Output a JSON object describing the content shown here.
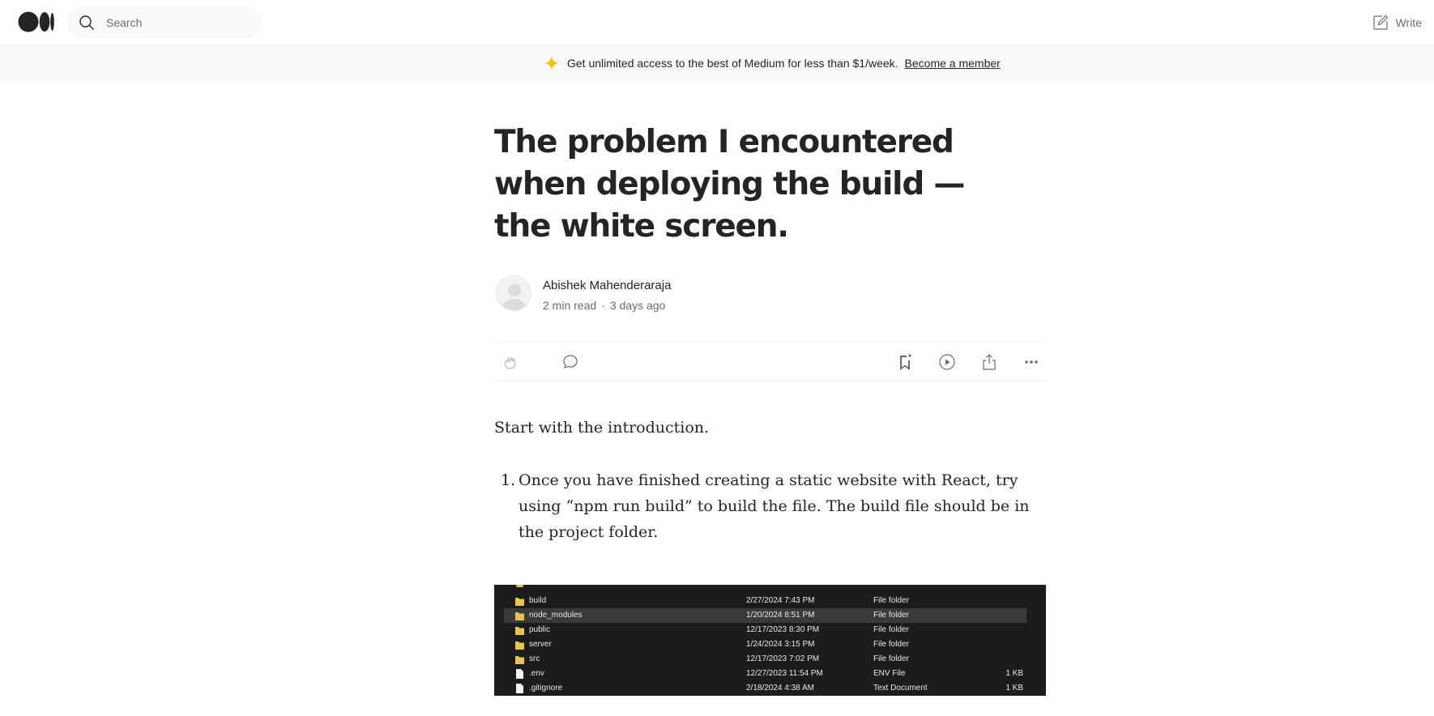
{
  "nav": {
    "search_placeholder": "Search",
    "write_label": "Write",
    "icons": [
      "medium-logo",
      "search-icon",
      "write-icon"
    ]
  },
  "banner": {
    "text": "Get unlimited access to the best of Medium for less than $1/week.",
    "link": "Become a member",
    "star_color": "#FFC017"
  },
  "article": {
    "title": "The problem I encountered when deploying the build — the white screen.",
    "author": "Abishek Mahenderaraja",
    "read_time": "2 min read",
    "separator": "·",
    "published": "3 days ago",
    "intro": "Start with the introduction.",
    "list": [
      {
        "num": "1.",
        "text": "Once you have finished creating a static website with React, try using “npm run build” to build the file. The build file should be in the project folder."
      }
    ]
  },
  "actions": [
    "clap-icon",
    "comment-icon",
    "bookmark-icon",
    "listen-icon",
    "share-icon",
    "more-icon"
  ],
  "figure": {
    "rows": [
      {
        "name": "build",
        "date": "2/27/2024 7:43 PM",
        "type": "File folder",
        "size": "",
        "kind": "folder",
        "selected": false
      },
      {
        "name": "node_modules",
        "date": "1/20/2024 8:51 PM",
        "type": "File folder",
        "size": "",
        "kind": "folder",
        "selected": true
      },
      {
        "name": "public",
        "date": "12/17/2023 8:30 PM",
        "type": "File folder",
        "size": "",
        "kind": "folder",
        "selected": false
      },
      {
        "name": "server",
        "date": "1/24/2024 3:15 PM",
        "type": "File folder",
        "size": "",
        "kind": "folder",
        "selected": false
      },
      {
        "name": "src",
        "date": "12/17/2023 7:02 PM",
        "type": "File folder",
        "size": "",
        "kind": "folder",
        "selected": false
      },
      {
        "name": ".env",
        "date": "12/27/2023 11:54 PM",
        "type": "ENV File",
        "size": "1 KB",
        "kind": "file",
        "selected": false
      },
      {
        "name": ".gitignore",
        "date": "2/18/2024 4:38 AM",
        "type": "Text Document",
        "size": "1 KB",
        "kind": "file",
        "selected": false
      }
    ]
  }
}
